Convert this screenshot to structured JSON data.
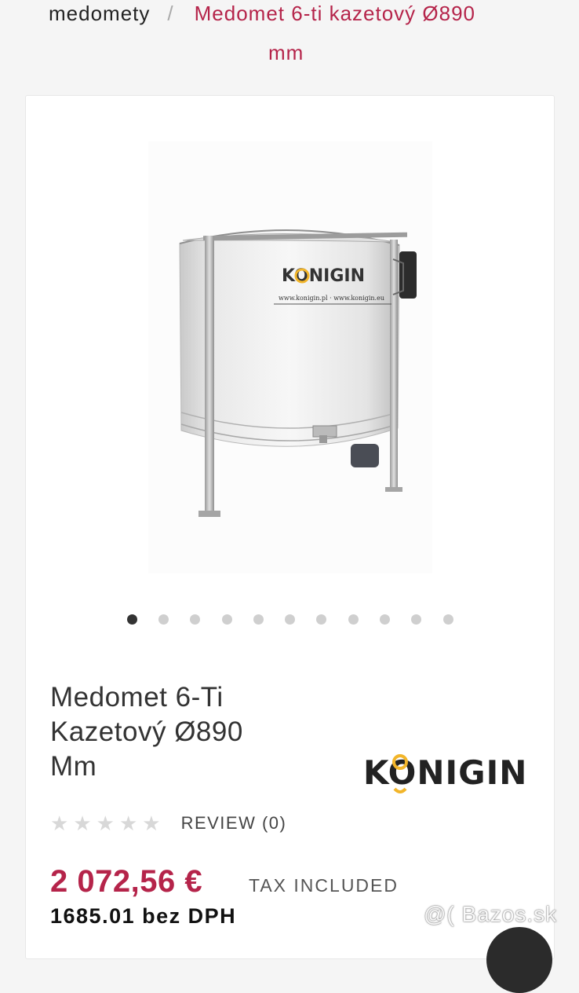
{
  "breadcrumb": {
    "parent": "medomety",
    "separator": "/",
    "current_line1": "Medomet 6-ti kazetový Ø890",
    "current_line2": "mm"
  },
  "product": {
    "title_line1": "Medomet 6-Ti",
    "title_line2": "Kazetový Ø890",
    "title_line3": "Mm",
    "image_brand": "KONIGIN",
    "image_url_text": "www.konigin.pl · www.konigin.eu",
    "brand_logo_text": "KONIGIN",
    "rating_stars": 0,
    "rating_max": 5,
    "review_label": "REVIEW (0)",
    "price": "2 072,56 €",
    "tax_label": "TAX INCLUDED",
    "price_net": "1685.01 bez DPH"
  },
  "gallery": {
    "total_images": 11,
    "active_index": 0
  },
  "watermark": "@( Bazos.sk",
  "colors": {
    "accent": "#b5244a",
    "logo_ring": "#f2b52a"
  }
}
